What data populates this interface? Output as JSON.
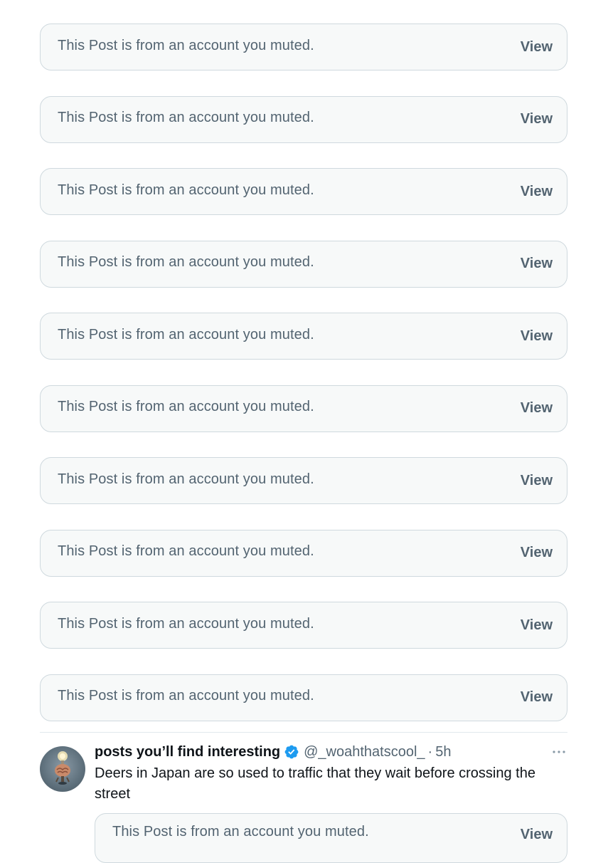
{
  "muted_posts": [
    {
      "text": "This Post is from an account you muted.",
      "action": "View"
    },
    {
      "text": "This Post is from an account you muted.",
      "action": "View"
    },
    {
      "text": "This Post is from an account you muted.",
      "action": "View"
    },
    {
      "text": "This Post is from an account you muted.",
      "action": "View"
    },
    {
      "text": "This Post is from an account you muted.",
      "action": "View"
    },
    {
      "text": "This Post is from an account you muted.",
      "action": "View"
    },
    {
      "text": "This Post is from an account you muted.",
      "action": "View"
    },
    {
      "text": "This Post is from an account you muted.",
      "action": "View"
    },
    {
      "text": "This Post is from an account you muted.",
      "action": "View"
    },
    {
      "text": "This Post is from an account you muted.",
      "action": "View"
    }
  ],
  "post": {
    "author_name": "posts you’ll find interesting",
    "verified": true,
    "handle": "@_woahthatscool_",
    "separator": "·",
    "time": "5h",
    "text": "Deers in Japan are so used to traffic that they wait before crossing the street",
    "quoted": {
      "text": "This Post is from an account you muted.",
      "action": "View"
    }
  },
  "colors": {
    "card_bg": "#f7f9f9",
    "card_border": "#cfd9de",
    "secondary_text": "#536471",
    "primary_text": "#0f1419",
    "verified_blue": "#1d9bf0"
  },
  "icons": {
    "verified": "verified-badge-icon",
    "more": "more-options-icon"
  }
}
